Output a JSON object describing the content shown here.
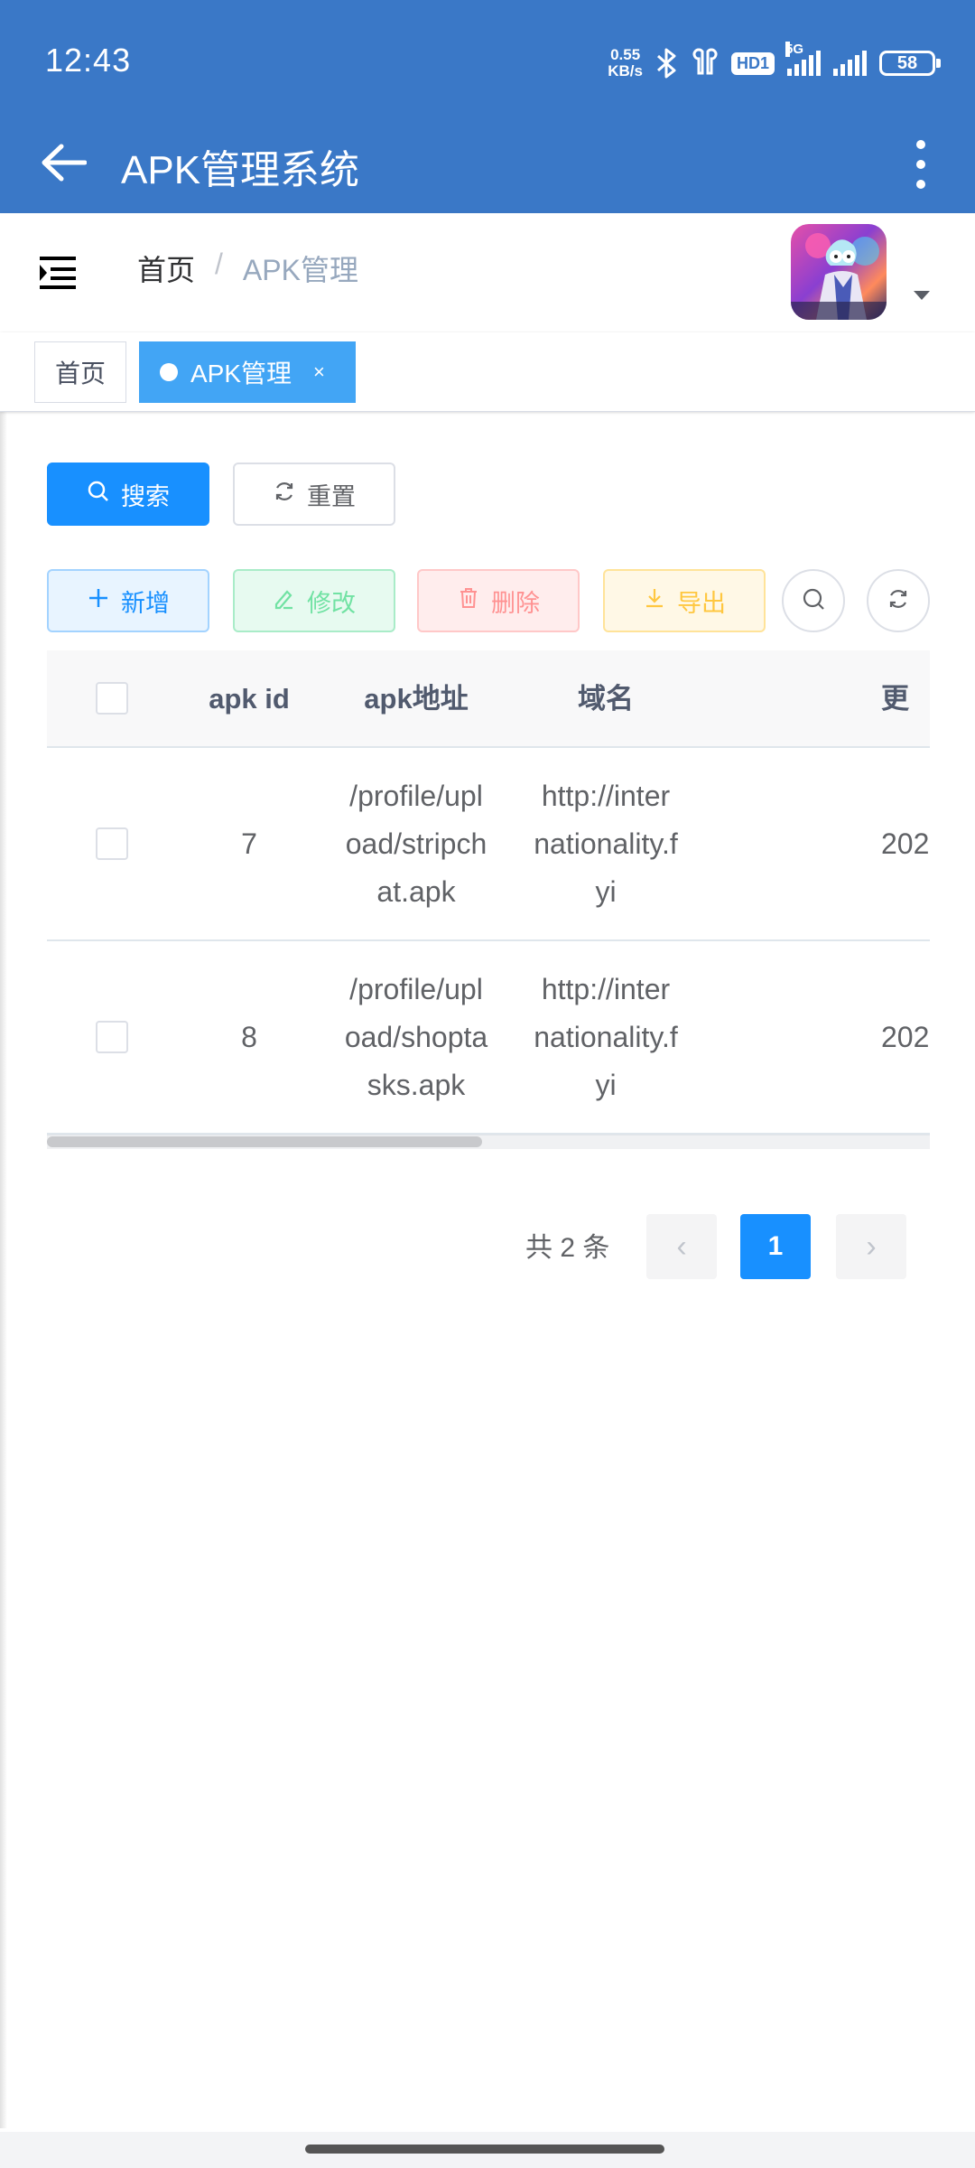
{
  "status_bar": {
    "time": "12:43",
    "net_speed_value": "0.55",
    "net_speed_unit": "KB/s",
    "hd_label": "HD1",
    "signal_label": "5G",
    "battery": "58"
  },
  "app_bar": {
    "title": "APK管理系统",
    "back_icon": "arrow-left-icon",
    "more_icon": "more-vertical-icon"
  },
  "navbar": {
    "breadcrumb": {
      "home": "首页",
      "separator": "/",
      "current": "APK管理"
    }
  },
  "tags": {
    "home": "首页",
    "active": "APK管理",
    "close": "×"
  },
  "buttons": {
    "search": "搜索",
    "reset": "重置",
    "add": "新增",
    "edit": "修改",
    "delete": "删除",
    "export": "导出"
  },
  "table": {
    "columns": [
      "apk id",
      "apk地址",
      "域名",
      "更"
    ],
    "rows": [
      {
        "id": "7",
        "address": "/profile/upload/stripchat.apk",
        "domain": "http://internationality.fyi",
        "time": "202"
      },
      {
        "id": "8",
        "address": "/profile/upload/shoptasks.apk",
        "domain": "http://internationality.fyi",
        "time": "202"
      }
    ]
  },
  "pagination": {
    "total": "共 2 条",
    "current_page": "1",
    "prev": "‹",
    "next": "›"
  },
  "colors": {
    "app_bar": "#3a78c7",
    "primary": "#1890ff",
    "tag_active": "#42a5f5"
  }
}
